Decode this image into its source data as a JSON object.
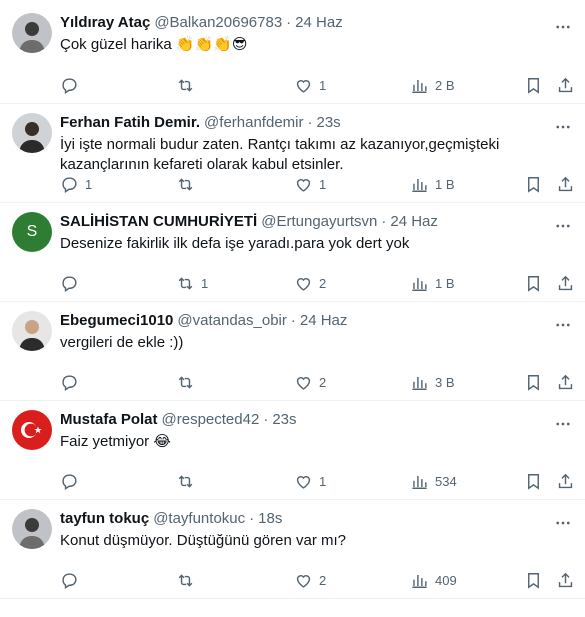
{
  "colors": {
    "text": "#0f1419",
    "secondary": "#536471",
    "divider": "#eff3f4",
    "s_avatar": "#2e7d32"
  },
  "tweets": [
    {
      "name": "Yıldıray Ataç",
      "handle": "@Balkan20696783",
      "time": "24 Haz",
      "text": "Çok güzel harika 👏👏👏😎",
      "reply": "",
      "retweet": "",
      "like": "1",
      "views": "2 B",
      "avatar": "person-photo"
    },
    {
      "name": "Ferhan Fatih Demir.",
      "handle": "@ferhanfdemir",
      "time": "23s",
      "text": "İyi işte normali budur zaten. Rantçı takımı az kazanıyor,geçmişteki kazançlarının kefareti olarak kabul etsinler.",
      "reply": "1",
      "retweet": "",
      "like": "1",
      "views": "1 B",
      "avatar": "person-photo"
    },
    {
      "name": "SALİHİSTAN CUMHURİYETİ",
      "handle": "@Ertungayurtsvn",
      "time": "24 Haz",
      "text": "Desenize fakirlik ilk defa işe yaradı.para yok dert yok",
      "reply": "",
      "retweet": "1",
      "like": "2",
      "views": "1 B",
      "avatar": "letter",
      "avatar_letter": "S"
    },
    {
      "name": "Ebegumeci1010",
      "handle": "@vatandas_obir",
      "time": "24 Haz",
      "text": "vergileri de ekle :))",
      "reply": "",
      "retweet": "",
      "like": "2",
      "views": "3 B",
      "avatar": "person-photo"
    },
    {
      "name": "Mustafa Polat",
      "handle": "@respected42",
      "time": "23s",
      "text": "Faiz yetmiyor 😂",
      "reply": "",
      "retweet": "",
      "like": "1",
      "views": "534",
      "avatar": "flag"
    },
    {
      "name": "tayfun tokuç",
      "handle": "@tayfuntokuc",
      "time": "18s",
      "text": "Konut düşmüyor. Düştüğünü gören var mı?",
      "reply": "",
      "retweet": "",
      "like": "2",
      "views": "409",
      "avatar": "person-photo"
    }
  ]
}
